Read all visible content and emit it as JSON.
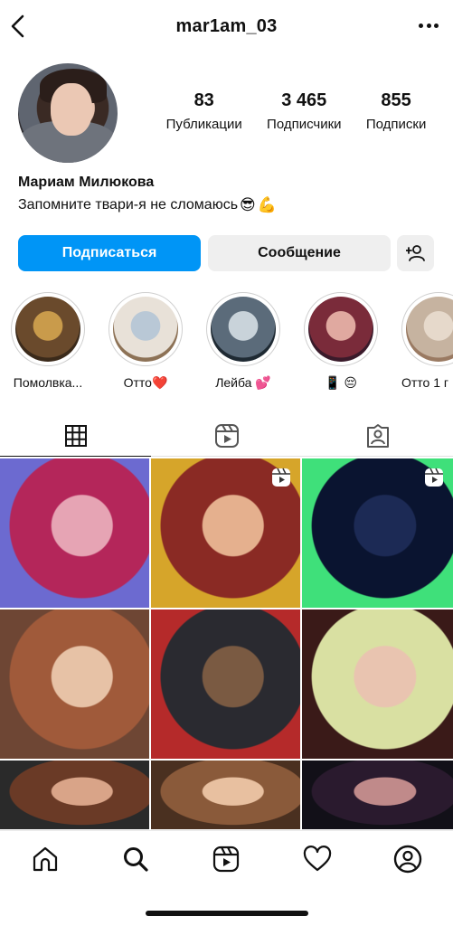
{
  "header": {
    "username": "mar1am_03"
  },
  "profile": {
    "stats": [
      {
        "value": "83",
        "label": "Публикации"
      },
      {
        "value": "3 465",
        "label": "Подписчики"
      },
      {
        "value": "855",
        "label": "Подписки"
      }
    ],
    "full_name": "Мариам Милюкова",
    "bio": "Запомните твари-я не сломаюсь",
    "bio_emojis": [
      "😎",
      "💪"
    ]
  },
  "actions": {
    "follow_label": "Подписаться",
    "message_label": "Сообщение"
  },
  "highlights": [
    {
      "label": "Помолвка...",
      "colors": [
        "#6a4a2c",
        "#c99b4b",
        "#3b2a1a"
      ]
    },
    {
      "label": "Отто❤️",
      "colors": [
        "#e8e1d8",
        "#b9c8d6",
        "#8d7256"
      ]
    },
    {
      "label": "Лейба 💕",
      "colors": [
        "#5b6b7a",
        "#c9d3da",
        "#1f2a33"
      ]
    },
    {
      "label": "📱 😔",
      "colors": [
        "#7a2b3a",
        "#e0a9a0",
        "#3a1a2a"
      ]
    },
    {
      "label": "Отто 1 г",
      "colors": [
        "#c6b3a0",
        "#e6d9cb",
        "#9a7a62"
      ]
    }
  ],
  "grid": {
    "posts": [
      {
        "colors": [
          "#b4265a",
          "#e6a4b4",
          "#6c6ad0"
        ],
        "reel": false
      },
      {
        "colors": [
          "#8a2a24",
          "#e5b08e",
          "#d6a52a"
        ],
        "reel": true
      },
      {
        "colors": [
          "#0a1430",
          "#1c2a55",
          "#3fe07a"
        ],
        "reel": true
      },
      {
        "colors": [
          "#a05a3a",
          "#e7c2a6",
          "#6e4634"
        ],
        "reel": false
      },
      {
        "colors": [
          "#2a2a30",
          "#7a5a42",
          "#b52a2a"
        ],
        "reel": false
      },
      {
        "colors": [
          "#d9e0a2",
          "#e9c4b0",
          "#3a1a18"
        ],
        "reel": false
      },
      {
        "colors": [
          "#6a3a26",
          "#d9a488",
          "#2a2a2a"
        ],
        "reel": false
      },
      {
        "colors": [
          "#8a5a3a",
          "#e8c0a0",
          "#4a3020"
        ],
        "reel": false
      },
      {
        "colors": [
          "#2a1a2e",
          "#c08a8a",
          "#121018"
        ],
        "reel": false
      }
    ]
  },
  "icons": {
    "back": "chevron-left-icon",
    "more": "more-horizontal-icon",
    "add_user": "add-user-icon",
    "tab_grid": "grid-icon",
    "tab_reels": "reels-icon",
    "tab_tagged": "tagged-user-icon",
    "nav": [
      "home-icon",
      "search-icon",
      "reels-icon",
      "heart-icon",
      "profile-icon"
    ]
  },
  "colors": {
    "accent": "#0095f6",
    "secondary_button": "#efefef"
  }
}
